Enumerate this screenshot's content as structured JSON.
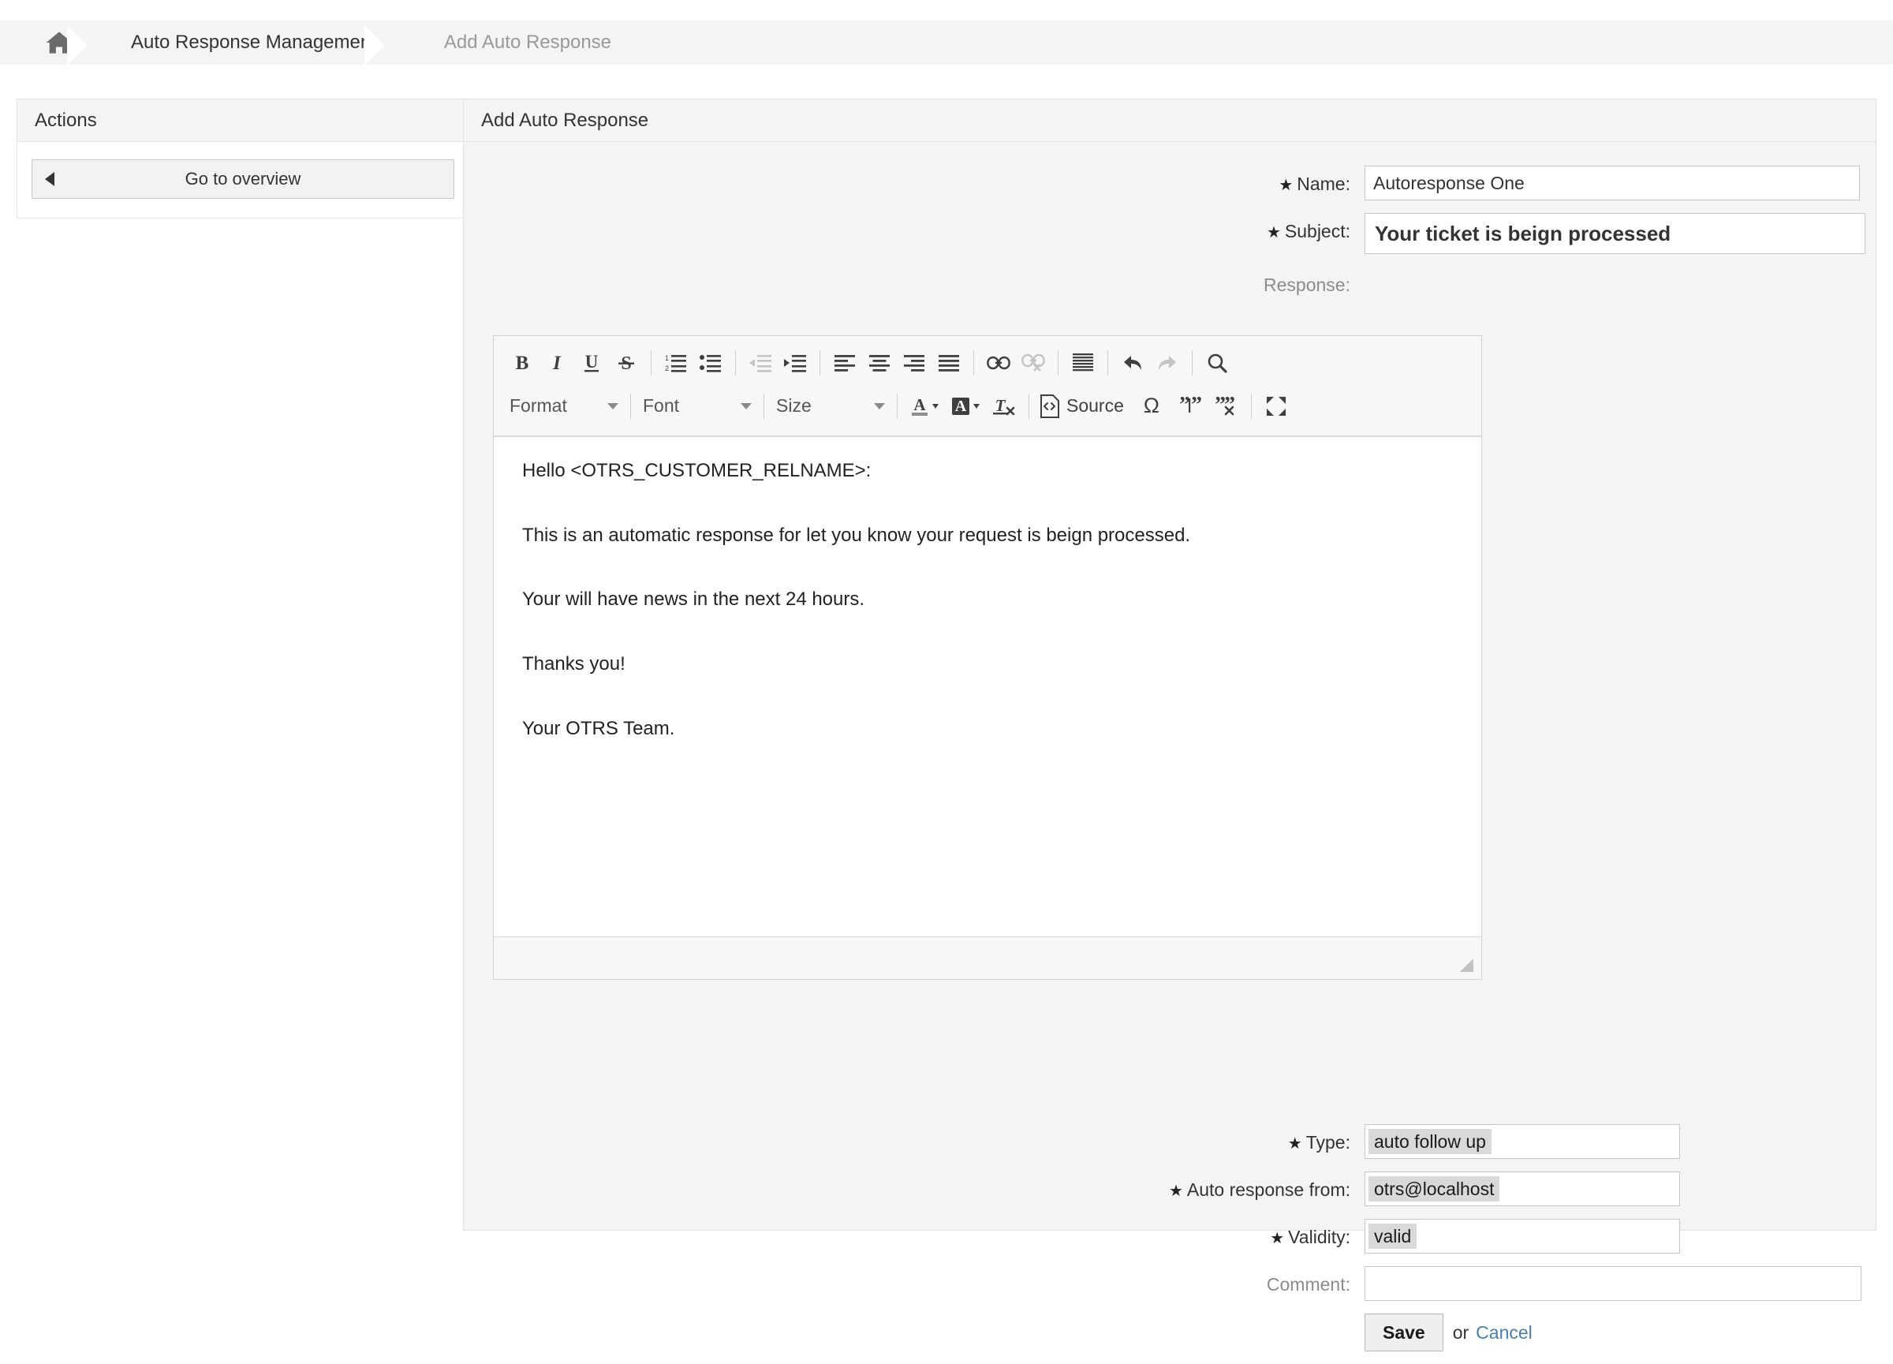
{
  "breadcrumb": {
    "home_icon": "home-icon",
    "items": [
      {
        "label": "Auto Response Management",
        "current": false
      },
      {
        "label": "Add Auto Response",
        "current": true
      }
    ]
  },
  "sidebar": {
    "title": "Actions",
    "overview_button": {
      "label": "Go to overview",
      "icon": "triangle-left-icon"
    }
  },
  "main": {
    "title": "Add Auto Response",
    "fields": {
      "name": {
        "label": "Name:",
        "required": true,
        "value": "Autoresponse One",
        "placeholder": ""
      },
      "subject": {
        "label": "Subject:",
        "required": true,
        "value": "Your ticket is beign processed",
        "placeholder": ""
      },
      "response": {
        "label": "Response:",
        "required": false
      },
      "type": {
        "label": "Type:",
        "required": true,
        "value": "auto follow up"
      },
      "auto_response_from": {
        "label": "Auto response from:",
        "required": true,
        "value": "otrs@localhost"
      },
      "validity": {
        "label": "Validity:",
        "required": true,
        "value": "valid"
      },
      "comment": {
        "label": "Comment:",
        "required": false,
        "value": "",
        "placeholder": ""
      }
    },
    "actions": {
      "save_label": "Save",
      "or_label": "or",
      "cancel_label": "Cancel"
    }
  },
  "editor": {
    "toolbar_row1": [
      {
        "name": "bold-icon",
        "kind": "icon",
        "enabled": true
      },
      {
        "name": "italic-icon",
        "kind": "icon",
        "enabled": true
      },
      {
        "name": "underline-icon",
        "kind": "icon",
        "enabled": true
      },
      {
        "name": "strikethrough-icon",
        "kind": "icon",
        "enabled": true
      },
      {
        "name": "separator",
        "kind": "sep"
      },
      {
        "name": "numbered-list-icon",
        "kind": "icon",
        "enabled": true
      },
      {
        "name": "bulleted-list-icon",
        "kind": "icon",
        "enabled": true
      },
      {
        "name": "separator",
        "kind": "sep"
      },
      {
        "name": "outdent-icon",
        "kind": "icon",
        "enabled": false
      },
      {
        "name": "indent-icon",
        "kind": "icon",
        "enabled": true
      },
      {
        "name": "separator",
        "kind": "sep"
      },
      {
        "name": "align-left-icon",
        "kind": "icon",
        "enabled": true
      },
      {
        "name": "align-center-icon",
        "kind": "icon",
        "enabled": true
      },
      {
        "name": "align-right-icon",
        "kind": "icon",
        "enabled": true
      },
      {
        "name": "align-justify-icon",
        "kind": "icon",
        "enabled": true
      },
      {
        "name": "separator",
        "kind": "sep"
      },
      {
        "name": "link-icon",
        "kind": "icon",
        "enabled": true
      },
      {
        "name": "unlink-icon",
        "kind": "icon",
        "enabled": false
      },
      {
        "name": "separator",
        "kind": "sep"
      },
      {
        "name": "blockquote-icon",
        "kind": "icon",
        "enabled": true
      },
      {
        "name": "separator",
        "kind": "sep"
      },
      {
        "name": "undo-icon",
        "kind": "icon",
        "enabled": true
      },
      {
        "name": "redo-icon",
        "kind": "icon",
        "enabled": false
      },
      {
        "name": "separator",
        "kind": "sep"
      },
      {
        "name": "find-icon",
        "kind": "icon",
        "enabled": true
      }
    ],
    "combos": [
      {
        "name": "format-combo",
        "label": "Format"
      },
      {
        "name": "font-combo",
        "label": "Font"
      },
      {
        "name": "size-combo",
        "label": "Size"
      }
    ],
    "source_label": "Source",
    "toolbar_row2_icons": [
      {
        "name": "text-color-icon",
        "enabled": true
      },
      {
        "name": "background-color-icon",
        "enabled": true
      },
      {
        "name": "remove-format-icon",
        "enabled": true
      },
      {
        "name": "source-icon",
        "enabled": true
      },
      {
        "name": "special-character-icon",
        "enabled": true,
        "glyph": "Ω"
      },
      {
        "name": "insert-quote-icon",
        "enabled": true
      },
      {
        "name": "remove-quote-icon",
        "enabled": true
      },
      {
        "name": "maximize-icon",
        "enabled": true
      }
    ],
    "content_paragraphs": [
      "Hello <OTRS_CUSTOMER_RELNAME>:",
      "This is an automatic response for let you know your request is beign processed.",
      "Your will have news in the next 24 hours.",
      "Thanks you!",
      "Your OTRS Team."
    ],
    "resize_grip": "resize-grip-icon"
  },
  "colors": {
    "page_bg": "#ffffff",
    "panel_bg": "#f4f4f4",
    "border": "#e2e2e2",
    "text": "#333333",
    "muted_text": "#8c8c8c",
    "link": "#4a7eab",
    "chip_bg": "#d9d9d9"
  }
}
